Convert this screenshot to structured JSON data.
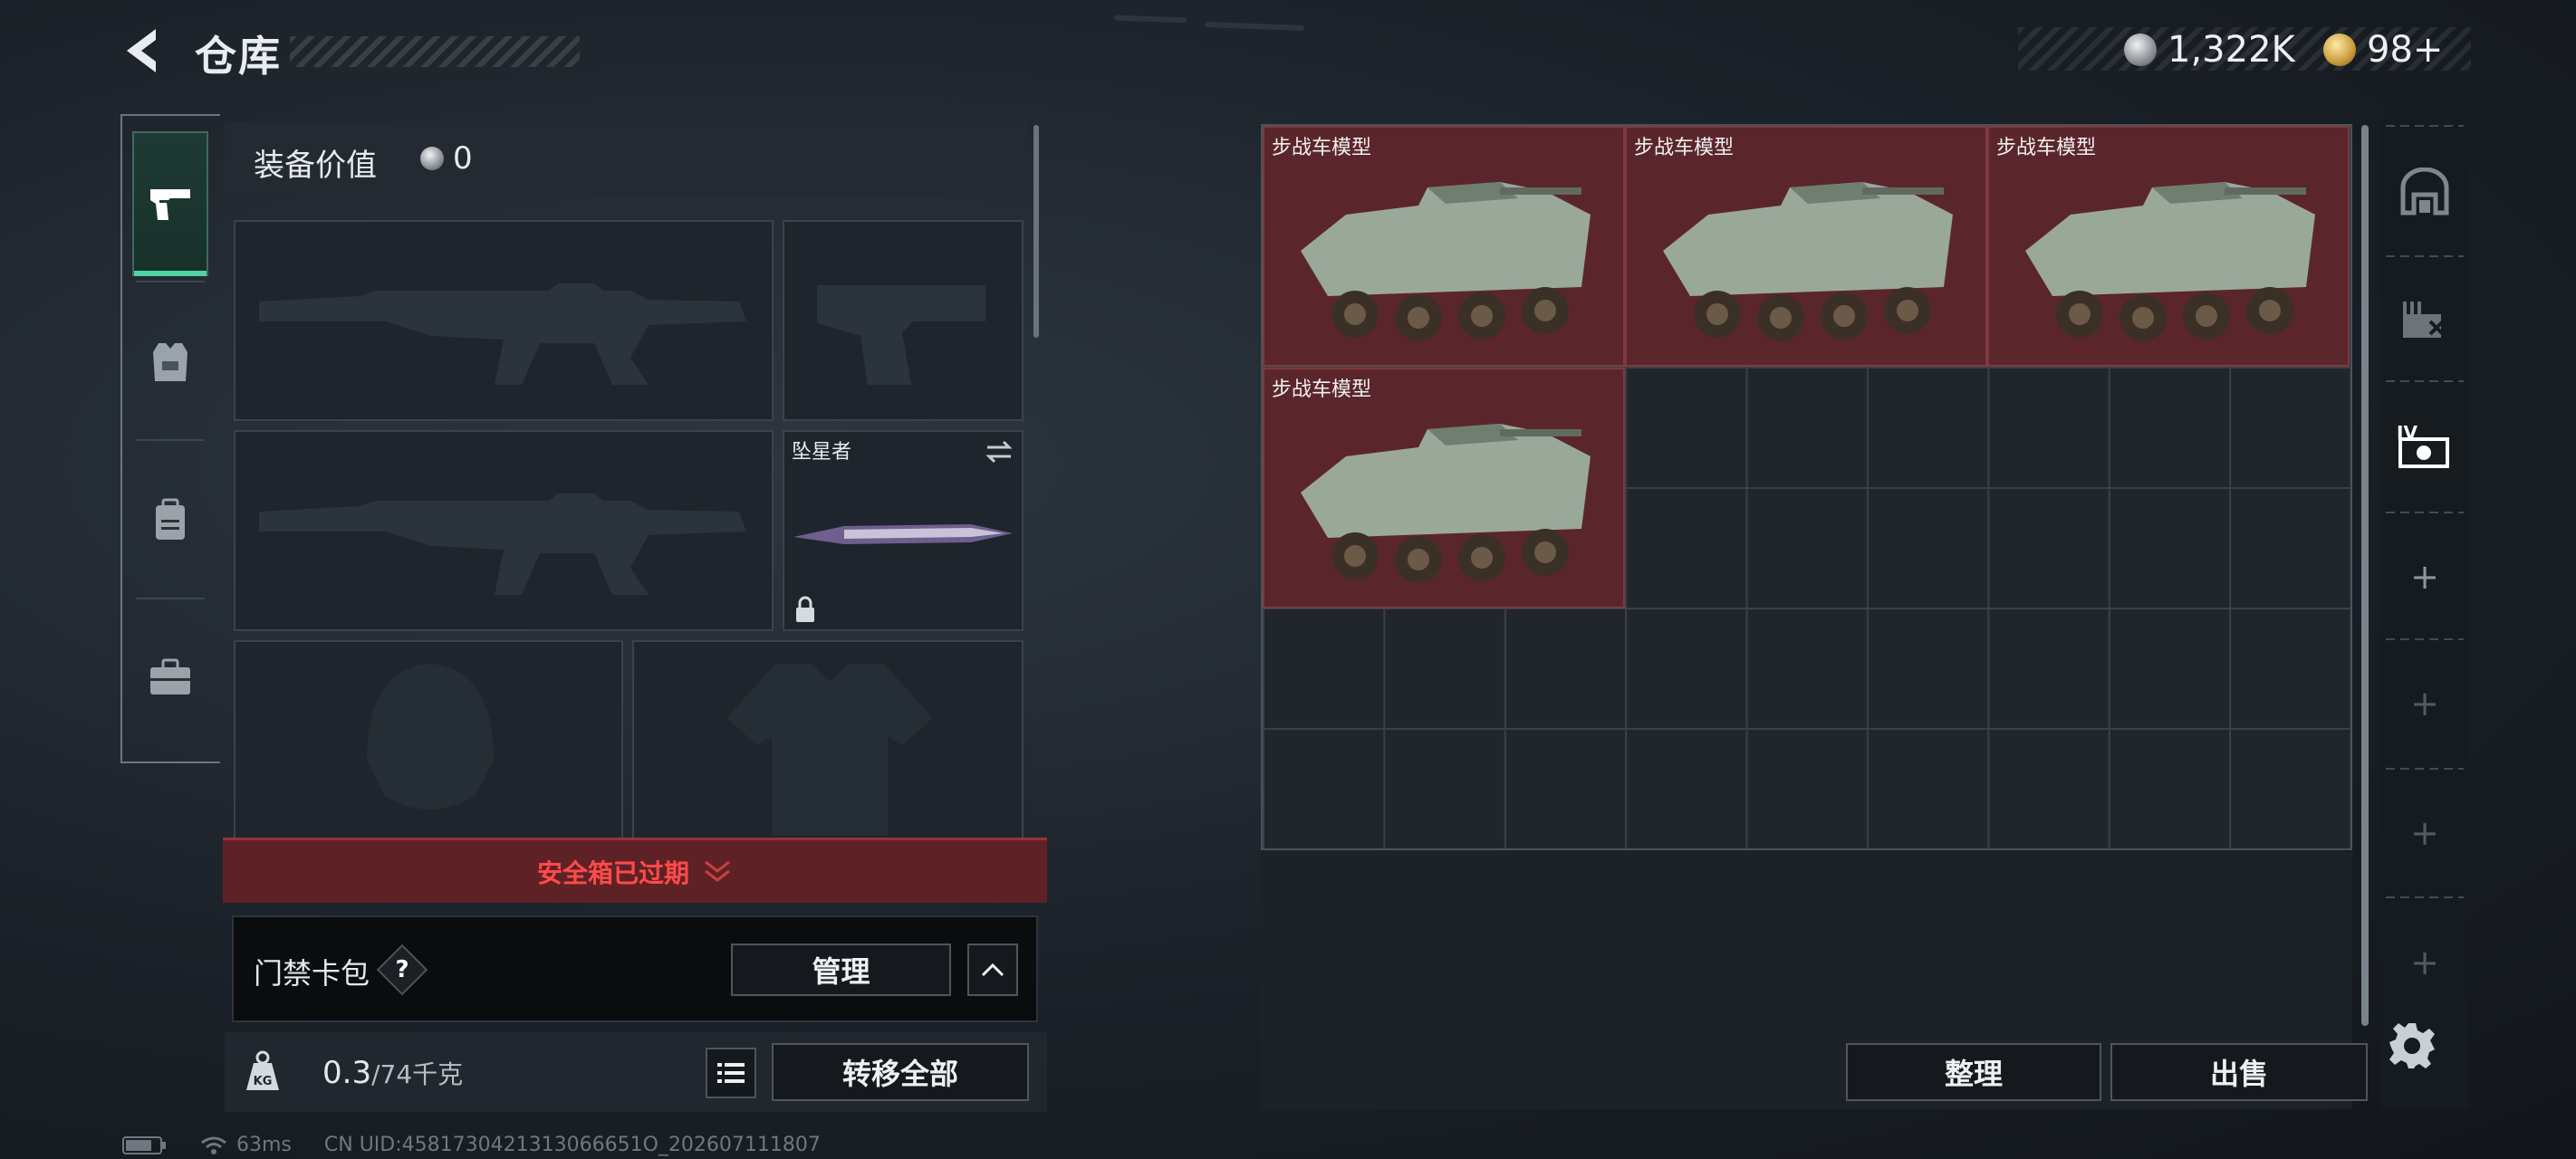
{
  "header": {
    "title": "仓库",
    "currency_silver": "1,322K",
    "currency_gold": "98+"
  },
  "left_rail": {
    "items": [
      {
        "name": "weapons",
        "icon": "pistol-icon",
        "active": true
      },
      {
        "name": "armor",
        "icon": "vest-icon",
        "active": false
      },
      {
        "name": "backpack",
        "icon": "backpack-icon",
        "active": false
      },
      {
        "name": "case",
        "icon": "briefcase-icon",
        "active": false
      }
    ]
  },
  "loadout": {
    "value_label": "装备价值",
    "value": "0",
    "melee_label": "坠星者",
    "safebox_text": "安全箱已过期",
    "card_title": "门禁卡包",
    "help": "?",
    "manage_button": "管理",
    "weight_current": "0.3",
    "weight_max": "/74千克",
    "transfer_all_button": "转移全部"
  },
  "storage": {
    "items": [
      {
        "label": "步战车模型"
      },
      {
        "label": "步战车模型"
      },
      {
        "label": "步战车模型"
      },
      {
        "label": "步战车模型"
      }
    ],
    "sort_button": "整理",
    "sell_button": "出售"
  },
  "right_rail": {
    "items": [
      "home-icon",
      "hazard-icon",
      "tier-iv-icon"
    ],
    "plus": "+"
  },
  "status_bar": {
    "ping": "63ms",
    "uid": "CN UID:4581730421313066651O_202607111807"
  },
  "colors": {
    "accent_green": "#4fd2a4",
    "danger_red": "#ff4a4a",
    "item_bg": "#5a262c"
  }
}
